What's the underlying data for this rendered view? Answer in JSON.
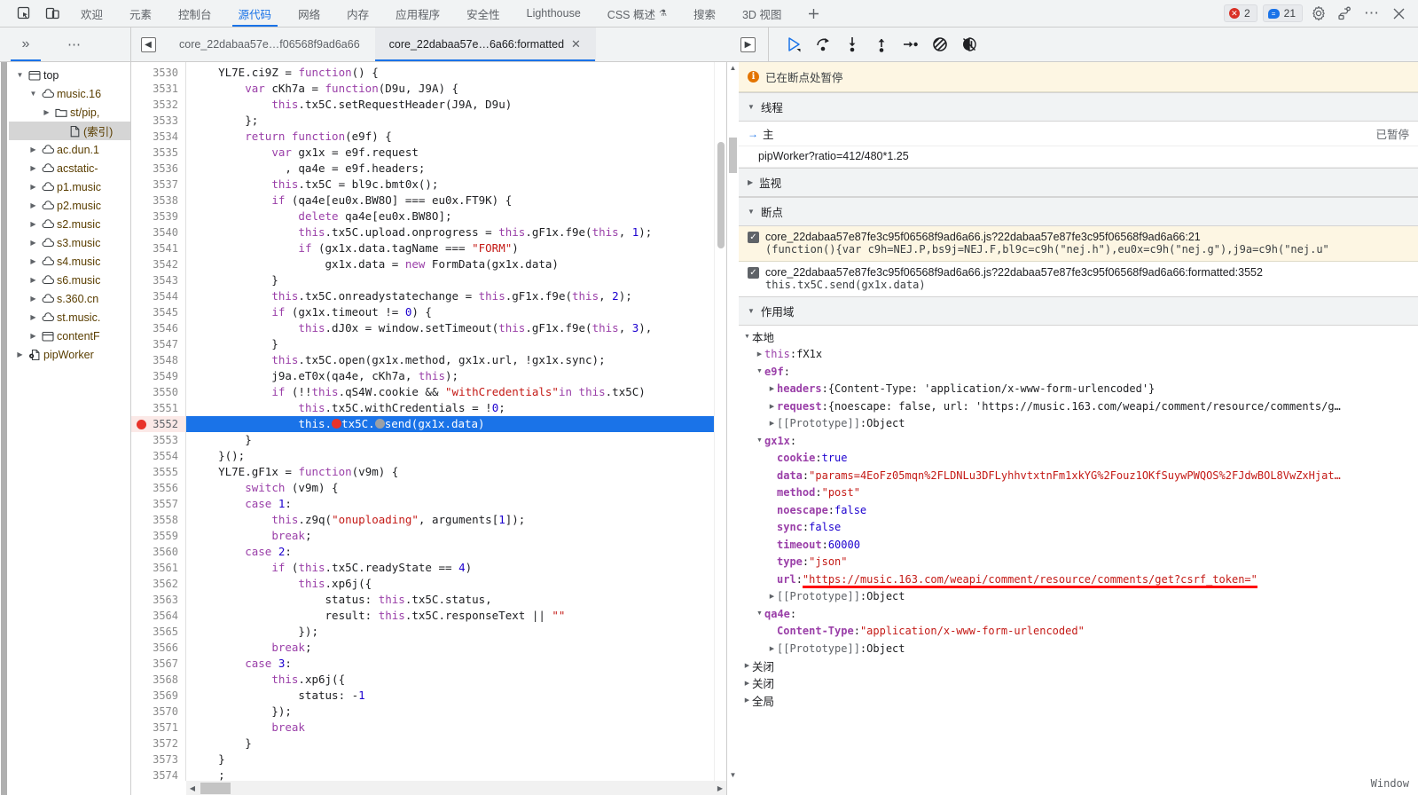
{
  "window": {
    "status_label": "Window"
  },
  "tabstrip": {
    "icons": [
      {
        "name": "inspect-icon",
        "glyph": "⬚"
      },
      {
        "name": "device-toolbar-icon",
        "glyph": "▯"
      }
    ],
    "tabs": [
      {
        "label": "欢迎",
        "active": false
      },
      {
        "label": "元素",
        "active": false
      },
      {
        "label": "控制台",
        "active": false
      },
      {
        "label": "源代码",
        "active": true
      },
      {
        "label": "网络",
        "active": false
      },
      {
        "label": "内存",
        "active": false
      },
      {
        "label": "应用程序",
        "active": false
      },
      {
        "label": "安全性",
        "active": false
      },
      {
        "label": "Lighthouse",
        "active": false
      },
      {
        "label": "CSS 概述",
        "active": false,
        "flask": "⚗"
      },
      {
        "label": "搜索",
        "active": false
      },
      {
        "label": "3D 视图",
        "active": false
      }
    ],
    "add_tab": "+",
    "error_count": "2",
    "warning_count": "21",
    "error_glyph": "✕",
    "warning_glyph": "=",
    "settings_icon": "⚙",
    "dock_icon": "⧉",
    "more_icon": "⋯",
    "close_icon": "✕",
    "error_color": "#d93025",
    "info_color": "#1a73e8"
  },
  "sources_toolbar": {
    "expand_label": "»",
    "more_label": "⋯",
    "collapse_sidebar_icon": "⬅",
    "expand_sidebar_icon": "➡",
    "file_tabs": [
      {
        "label": "core_22dabaa57e…f06568f9ad6a66",
        "active": false,
        "closable": false
      },
      {
        "label": "core_22dabaa57e…6a66:formatted",
        "active": true,
        "closable": true,
        "close": "✕"
      }
    ],
    "debug_buttons": [
      {
        "name": "resume-button",
        "glyph": "▷",
        "accent": true
      },
      {
        "name": "step-over-button",
        "glyph": "↷"
      },
      {
        "name": "step-into-button",
        "glyph": "↓"
      },
      {
        "name": "step-out-button",
        "glyph": "↑"
      },
      {
        "name": "step-button",
        "glyph": "→"
      },
      {
        "name": "deactivate-breakpoints-button",
        "glyph": "⊘"
      },
      {
        "name": "pause-on-exceptions-button",
        "glyph": "⏸"
      }
    ]
  },
  "navigator": {
    "items": [
      {
        "label": "top",
        "indent": 0,
        "twisty": "▼",
        "icon": "frame",
        "selected": false
      },
      {
        "label": "music.16",
        "indent": 1,
        "twisty": "▼",
        "icon": "cloud",
        "selected": false
      },
      {
        "label": "st/pip,",
        "indent": 2,
        "twisty": "▶",
        "icon": "folder",
        "selected": false
      },
      {
        "label": "(索引)",
        "indent": 3,
        "twisty": "",
        "icon": "file",
        "selected": true
      },
      {
        "label": "ac.dun.1",
        "indent": 1,
        "twisty": "▶",
        "icon": "cloud",
        "selected": false
      },
      {
        "label": "acstatic-",
        "indent": 1,
        "twisty": "▶",
        "icon": "cloud",
        "selected": false
      },
      {
        "label": "p1.music",
        "indent": 1,
        "twisty": "▶",
        "icon": "cloud",
        "selected": false
      },
      {
        "label": "p2.music",
        "indent": 1,
        "twisty": "▶",
        "icon": "cloud",
        "selected": false
      },
      {
        "label": "s2.music",
        "indent": 1,
        "twisty": "▶",
        "icon": "cloud",
        "selected": false
      },
      {
        "label": "s3.music",
        "indent": 1,
        "twisty": "▶",
        "icon": "cloud",
        "selected": false
      },
      {
        "label": "s4.music",
        "indent": 1,
        "twisty": "▶",
        "icon": "cloud",
        "selected": false
      },
      {
        "label": "s6.music",
        "indent": 1,
        "twisty": "▶",
        "icon": "cloud",
        "selected": false
      },
      {
        "label": "s.360.cn",
        "indent": 1,
        "twisty": "▶",
        "icon": "cloud",
        "selected": false
      },
      {
        "label": "st.music.",
        "indent": 1,
        "twisty": "▶",
        "icon": "cloud",
        "selected": false
      },
      {
        "label": "contentF",
        "indent": 1,
        "twisty": "▶",
        "icon": "frame",
        "selected": false
      },
      {
        "label": "pipWorker",
        "indent": 0,
        "twisty": "▶",
        "icon": "worker",
        "selected": false
      }
    ]
  },
  "editor": {
    "first_line": 3530,
    "current_line": 3552,
    "lines": [
      {
        "n": 3530,
        "html": "    <span class='pl'>YL7E</span>.<span class='pl'>ci9Z</span> = <span class='kw'>function</span>() {"
      },
      {
        "n": 3531,
        "html": "        <span class='kw'>var</span> cKh7a = <span class='kw'>function</span>(D9u, J9A) {"
      },
      {
        "n": 3532,
        "html": "            <span class='kw'>this</span>.tx5C.setRequestHeader(J9A, D9u)"
      },
      {
        "n": 3533,
        "html": "        };"
      },
      {
        "n": 3534,
        "html": "        <span class='kw'>return</span> <span class='kw'>function</span>(e9f) {"
      },
      {
        "n": 3535,
        "html": "            <span class='kw'>var</span> gx1x = e9f.request"
      },
      {
        "n": 3536,
        "html": "              , qa4e = e9f.headers;"
      },
      {
        "n": 3537,
        "html": "            <span class='kw'>this</span>.tx5C = bl9c.bmt0x();"
      },
      {
        "n": 3538,
        "html": "            <span class='kw'>if</span> (qa4e[eu0x.BW8O] === eu0x.FT9K) {"
      },
      {
        "n": 3539,
        "html": "                <span class='kw'>delete</span> qa4e[eu0x.BW8O];"
      },
      {
        "n": 3540,
        "html": "                <span class='kw'>this</span>.tx5C.upload.onprogress = <span class='kw'>this</span>.gF1x.f9e(<span class='kw'>this</span>, <span class='num'>1</span>);"
      },
      {
        "n": 3541,
        "html": "                <span class='kw'>if</span> (gx1x.data.tagName === <span class='str'>\"FORM\"</span>)"
      },
      {
        "n": 3542,
        "html": "                    gx1x.data = <span class='kw'>new</span> FormData(gx1x.data)"
      },
      {
        "n": 3543,
        "html": "            }"
      },
      {
        "n": 3544,
        "html": "            <span class='kw'>this</span>.tx5C.onreadystatechange = <span class='kw'>this</span>.gF1x.f9e(<span class='kw'>this</span>, <span class='num'>2</span>);"
      },
      {
        "n": 3545,
        "html": "            <span class='kw'>if</span> (gx1x.timeout != <span class='num'>0</span>) {"
      },
      {
        "n": 3546,
        "html": "                <span class='kw'>this</span>.dJ0x = window.setTimeout(<span class='kw'>this</span>.gF1x.f9e(<span class='kw'>this</span>, <span class='num'>3</span>),"
      },
      {
        "n": 3547,
        "html": "            }"
      },
      {
        "n": 3548,
        "html": "            <span class='kw'>this</span>.tx5C.open(gx1x.method, gx1x.url, !gx1x.sync);"
      },
      {
        "n": 3549,
        "html": "            j9a.eT0x(qa4e, cKh7a, <span class='kw'>this</span>);"
      },
      {
        "n": 3550,
        "html": "            <span class='kw'>if</span> (!!<span class='kw'>this</span>.qS4W.cookie &amp;&amp; <span class='str'>\"withCredentials\"</span><span class='kw'>in</span> <span class='kw'>this</span>.tx5C)"
      },
      {
        "n": 3551,
        "html": "                <span class='kw'>this</span>.tx5C.withCredentials = !<span class='num'>0</span>;"
      },
      {
        "n": 3552,
        "html": "                <span class='kw'>this</span>.<span class='inl-red'></span>tx5C.<span class='inl-gray'></span>send(gx1x.data)"
      },
      {
        "n": 3553,
        "html": "        }"
      },
      {
        "n": 3554,
        "html": "    }();"
      },
      {
        "n": 3555,
        "html": "    <span class='pl'>YL7E</span>.<span class='pl'>gF1x</span> = <span class='kw'>function</span>(v9m) {"
      },
      {
        "n": 3556,
        "html": "        <span class='kw'>switch</span> (v9m) {"
      },
      {
        "n": 3557,
        "html": "        <span class='kw'>case</span> <span class='num'>1</span>:"
      },
      {
        "n": 3558,
        "html": "            <span class='kw'>this</span>.z9q(<span class='str'>\"onuploading\"</span>, arguments[<span class='num'>1</span>]);"
      },
      {
        "n": 3559,
        "html": "            <span class='kw'>break</span>;"
      },
      {
        "n": 3560,
        "html": "        <span class='kw'>case</span> <span class='num'>2</span>:"
      },
      {
        "n": 3561,
        "html": "            <span class='kw'>if</span> (<span class='kw'>this</span>.tx5C.readyState == <span class='num'>4</span>)"
      },
      {
        "n": 3562,
        "html": "                <span class='kw'>this</span>.xp6j({"
      },
      {
        "n": 3563,
        "html": "                    status: <span class='kw'>this</span>.tx5C.status,"
      },
      {
        "n": 3564,
        "html": "                    result: <span class='kw'>this</span>.tx5C.responseText || <span class='str'>\"\"</span>"
      },
      {
        "n": 3565,
        "html": "                });"
      },
      {
        "n": 3566,
        "html": "            <span class='kw'>break</span>;"
      },
      {
        "n": 3567,
        "html": "        <span class='kw'>case</span> <span class='num'>3</span>:"
      },
      {
        "n": 3568,
        "html": "            <span class='kw'>this</span>.xp6j({"
      },
      {
        "n": 3569,
        "html": "                status: -<span class='num'>1</span>"
      },
      {
        "n": 3570,
        "html": "            });"
      },
      {
        "n": 3571,
        "html": "            <span class='kw'>break</span>"
      },
      {
        "n": 3572,
        "html": "        }"
      },
      {
        "n": 3573,
        "html": "    }"
      },
      {
        "n": 3574,
        "html": "    ;"
      },
      {
        "n": 3575,
        "html": ""
      }
    ]
  },
  "debugger": {
    "pause_message": "已在断点处暂停",
    "threads": {
      "title": "线程",
      "twisty": "▼",
      "main_label": "主",
      "main_state": "已暂停",
      "worker_label": "pipWorker?ratio=412/480*1.25"
    },
    "watch": {
      "title": "监视",
      "twisty": "▶"
    },
    "breakpoints": {
      "title": "断点",
      "twisty": "▼",
      "items": [
        {
          "checked": true,
          "location": "core_22dabaa57e87fe3c95f06568f9ad6a66.js?22dabaa57e87fe3c95f06568f9ad6a66:21",
          "code": "(function(){var c9h=NEJ.P,bs9j=NEJ.F,bl9c=c9h(\"nej.h\"),eu0x=c9h(\"nej.g\"),j9a=c9h(\"nej.u\"",
          "highlighted": true
        },
        {
          "checked": true,
          "location": "core_22dabaa57e87fe3c95f06568f9ad6a66.js?22dabaa57e87fe3c95f06568f9ad6a66:formatted:3552",
          "code": "this.tx5C.send(gx1x.data)",
          "highlighted": false
        }
      ]
    },
    "scope": {
      "title": "作用域",
      "twisty": "▼",
      "rows": [
        {
          "indent": 0,
          "twisty": "▼",
          "name": "本地",
          "cn": true
        },
        {
          "indent": 1,
          "twisty": "▶",
          "name": "this",
          "sep": ": ",
          "value": "fX1x",
          "vclass": "v-obj",
          "bold": false
        },
        {
          "indent": 1,
          "twisty": "▼",
          "name": "e9f",
          "sep": ":",
          "value": "",
          "vclass": "v-obj",
          "bold": true
        },
        {
          "indent": 2,
          "twisty": "▶",
          "name": "headers",
          "sep": ": ",
          "value": "{Content-Type: 'application/x-www-form-urlencoded'}",
          "vclass": "v-obj",
          "bold": true
        },
        {
          "indent": 2,
          "twisty": "▶",
          "name": "request",
          "sep": ": ",
          "value": "{noescape: false, url: 'https://music.163.com/weapi/comment/resource/comments/g…",
          "vclass": "v-obj",
          "bold": true
        },
        {
          "indent": 2,
          "twisty": "▶",
          "name": "[[Prototype]]",
          "sep": ": ",
          "value": "Object",
          "vclass": "v-obj",
          "proto": true
        },
        {
          "indent": 1,
          "twisty": "▼",
          "name": "gx1x",
          "sep": ":",
          "value": "",
          "vclass": "v-obj",
          "bold": true
        },
        {
          "indent": 2,
          "twisty": "",
          "name": "cookie",
          "sep": ": ",
          "value": "true",
          "vclass": "v-bool",
          "bold": true
        },
        {
          "indent": 2,
          "twisty": "",
          "name": "data",
          "sep": ": ",
          "value": "\"params=4EoFz05mqn%2FLDNLu3DFLyhhvtxtnFm1xkYG%2Fouz1OKfSuywPWQOS%2FJdwBOL8VwZxHjat…",
          "vclass": "v-str",
          "bold": true
        },
        {
          "indent": 2,
          "twisty": "",
          "name": "method",
          "sep": ": ",
          "value": "\"post\"",
          "vclass": "v-str",
          "bold": true
        },
        {
          "indent": 2,
          "twisty": "",
          "name": "noescape",
          "sep": ": ",
          "value": "false",
          "vclass": "v-bool",
          "bold": true
        },
        {
          "indent": 2,
          "twisty": "",
          "name": "sync",
          "sep": ": ",
          "value": "false",
          "vclass": "v-bool",
          "bold": true
        },
        {
          "indent": 2,
          "twisty": "",
          "name": "timeout",
          "sep": ": ",
          "value": "60000",
          "vclass": "v-num",
          "bold": true
        },
        {
          "indent": 2,
          "twisty": "",
          "name": "type",
          "sep": ": ",
          "value": "\"json\"",
          "vclass": "v-str",
          "bold": true
        },
        {
          "indent": 2,
          "twisty": "",
          "name": "url",
          "sep": ": ",
          "value": "\"https://music.163.com/weapi/comment/resource/comments/get?csrf_token=\"",
          "vclass": "v-str",
          "bold": true,
          "underline": true
        },
        {
          "indent": 2,
          "twisty": "▶",
          "name": "[[Prototype]]",
          "sep": ": ",
          "value": "Object",
          "vclass": "v-obj",
          "proto": true
        },
        {
          "indent": 1,
          "twisty": "▼",
          "name": "qa4e",
          "sep": ":",
          "value": "",
          "vclass": "v-obj",
          "bold": true
        },
        {
          "indent": 2,
          "twisty": "",
          "name": "Content-Type",
          "sep": ": ",
          "value": "\"application/x-www-form-urlencoded\"",
          "vclass": "v-str",
          "bold": true
        },
        {
          "indent": 2,
          "twisty": "▶",
          "name": "[[Prototype]]",
          "sep": ": ",
          "value": "Object",
          "vclass": "v-obj",
          "proto": true
        },
        {
          "indent": 0,
          "twisty": "▶",
          "name": "关闭",
          "cn": true
        },
        {
          "indent": 0,
          "twisty": "▶",
          "name": "关闭",
          "cn": true
        },
        {
          "indent": 0,
          "twisty": "▶",
          "name": "全局",
          "cn": true
        }
      ]
    }
  }
}
